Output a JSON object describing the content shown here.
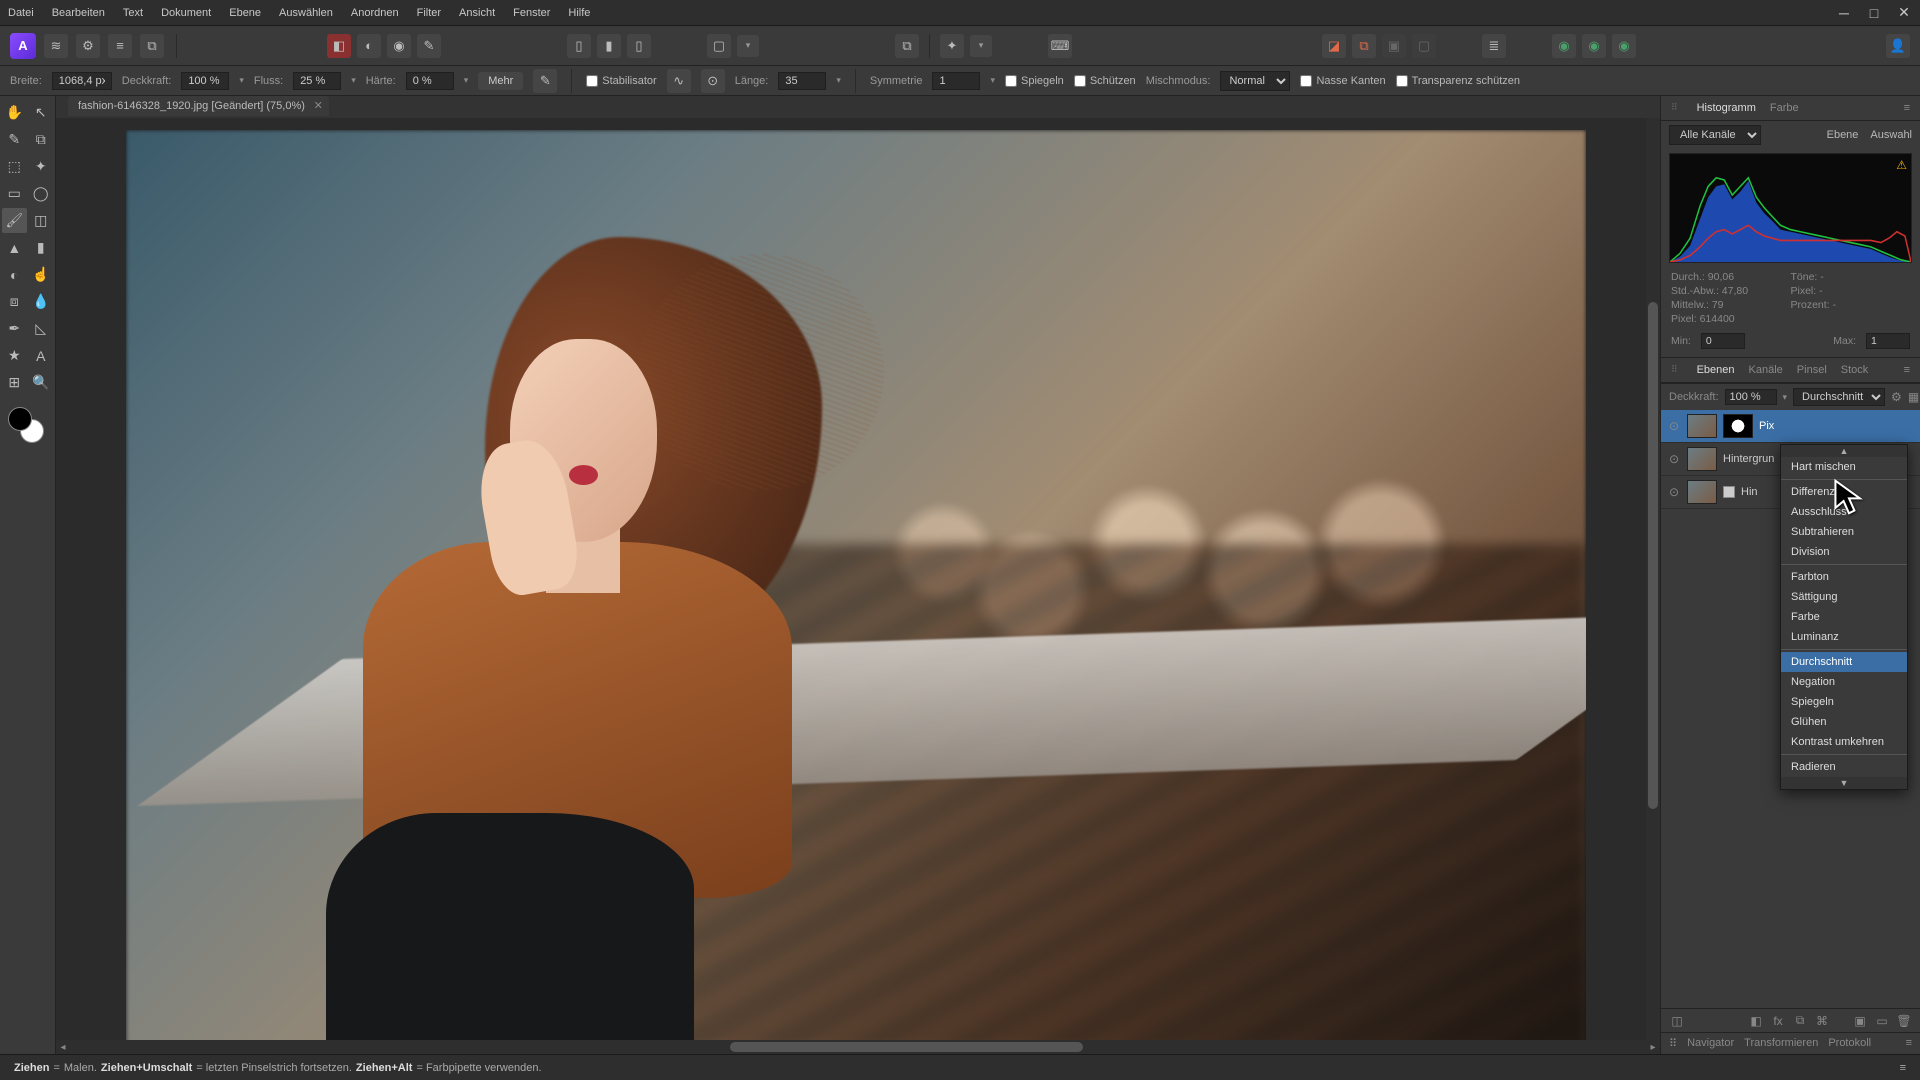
{
  "menu": [
    "Datei",
    "Bearbeiten",
    "Text",
    "Dokument",
    "Ebene",
    "Auswählen",
    "Anordnen",
    "Filter",
    "Ansicht",
    "Fenster",
    "Hilfe"
  ],
  "doc": {
    "tab_title": "fashion-6146328_1920.jpg [Geändert] (75,0%)"
  },
  "ctx": {
    "breite_label": "Breite:",
    "breite_value": "1068,4 px",
    "deckkraft_label": "Deckkraft:",
    "deckkraft_value": "100 %",
    "fluss_label": "Fluss:",
    "fluss_value": "25 %",
    "haerte_label": "Härte:",
    "haerte_value": "0 %",
    "mehr": "Mehr",
    "stabilisator": "Stabilisator",
    "laenge_label": "Länge:",
    "laenge_value": "35",
    "symmetrie_label": "Symmetrie",
    "symmetrie_value": "1",
    "spiegeln": "Spiegeln",
    "schuetzen": "Schützen",
    "mischmodus_label": "Mischmodus:",
    "mischmodus_value": "Normal",
    "nasse_kanten": "Nasse Kanten",
    "transparenz": "Transparenz schützen"
  },
  "hist_panel": {
    "tab_hist": "Histogramm",
    "tab_color": "Farbe",
    "channels": "Alle Kanäle",
    "ebene": "Ebene",
    "auswahl": "Auswahl",
    "durch": "Durch.: 90,06",
    "stdabw": "Std.-Abw.: 47,80",
    "mittelw": "Mittelw.: 79",
    "pixel": "Pixel: 614400",
    "toene": "Töne: -",
    "pixel2": "Pixel: -",
    "prozent": "Prozent: -",
    "min_label": "Min:",
    "min_value": "0",
    "max_label": "Max:",
    "max_value": "1"
  },
  "layers_panel": {
    "tab_ebenen": "Ebenen",
    "tab_kanaele": "Kanäle",
    "tab_pinsel": "Pinsel",
    "tab_stock": "Stock",
    "deckkraft_label": "Deckkraft:",
    "deckkraft_value": "100 %",
    "blend_value": "Durchschnitt",
    "layers": [
      {
        "name": "Pix"
      },
      {
        "name": "Hintergrun"
      },
      {
        "name": "Hin"
      }
    ]
  },
  "blend_modes": {
    "items_top": [
      "Hart mischen"
    ],
    "items_a": [
      "Differenz",
      "Ausschluss",
      "Subtrahieren",
      "Division"
    ],
    "items_b": [
      "Farbton",
      "Sättigung",
      "Farbe",
      "Luminanz"
    ],
    "items_c": [
      "Durchschnitt",
      "Negation",
      "Spiegeln",
      "Glühen",
      "Kontrast umkehren"
    ],
    "items_d": [
      "Radieren"
    ],
    "selected": "Durchschnitt"
  },
  "nav_panel": {
    "navigator": "Navigator",
    "transformieren": "Transformieren",
    "protokoll": "Protokoll"
  },
  "status": {
    "ziehen": "Ziehen",
    "eq": " = ",
    "malen": "Malen. ",
    "ziehen_umschalt": "Ziehen+Umschalt",
    "letzten": " = letzten Pinselstrich fortsetzen. ",
    "ziehen_alt": "Ziehen+Alt",
    "farbpipette": " = Farbpipette verwenden."
  }
}
